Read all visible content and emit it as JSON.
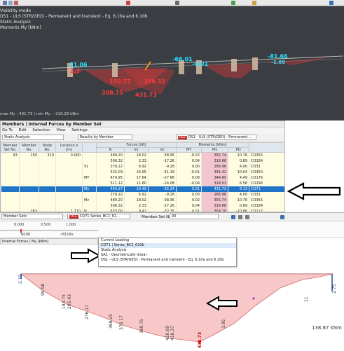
{
  "view3d": {
    "info_lines": [
      "Visibility mode",
      "DS1 - ULS (STR/GEO) - Permanent and transient - Eq. 6.10a and 6.10b",
      "Static Analysis",
      "Moments My [kNm]"
    ],
    "footer": "max My : 431.73 | min My : -210.29 kNm",
    "labels_red": [
      "150.57",
      "169.32",
      "308.75",
      "431.73",
      "2.7"
    ],
    "labels_cyan": [
      "-21.06",
      "-66.01",
      "-0.01",
      "-81.66",
      "-1.89"
    ]
  },
  "panel": {
    "title": "Members | Internal Forces by Member Set",
    "menu": [
      "Go To",
      "Edit",
      "Selection",
      "View",
      "Settings"
    ],
    "analysis": "Static Analysis",
    "results": "Results by Member",
    "combo_badge": "ULS",
    "combo_text": "DS1 - ULS (STR/GEO) - Permanent ...",
    "columns": [
      "Member Set No.",
      "Member No.",
      "Node No.",
      "Location x [m]",
      "",
      "N",
      "Vy",
      "Vz",
      "MT",
      "My",
      "Mz",
      ""
    ],
    "group_forces": "Forces [kN]",
    "group_moments": "Moments [kNm]",
    "rows": [
      {
        "set": "93",
        "member": "150",
        "node": "310",
        "loc": "0.000",
        "sym": "",
        "n": "489.20",
        "vy": "18.02",
        "vz": "-38.95",
        "mt": "-0.02",
        "my": "355.74",
        "mz": "10.76",
        "co": "CO355"
      },
      {
        "set": "",
        "member": "",
        "node": "",
        "loc": "",
        "sym": "",
        "n": "506.32",
        "vy": "2.33",
        "vz": "-17.26",
        "mt": "0.04",
        "my": "316.68",
        "mz": "0.89",
        "co": "CO184"
      },
      {
        "set": "",
        "member": "",
        "node": "",
        "loc": "",
        "sym": "Vz",
        "n": "278.22",
        "vy": "6.92",
        "vz": "-9.28",
        "mt": "0.00",
        "my": "166.96",
        "mz": "4.00",
        "co": "CO31"
      },
      {
        "set": "",
        "member": "",
        "node": "",
        "loc": "",
        "sym": "",
        "n": "525.03",
        "vy": "16.95",
        "vz": "-41.19",
        "mt": "-0.01",
        "my": "391.42",
        "mz": "10.04",
        "co": "CO350"
      },
      {
        "set": "",
        "member": "",
        "node": "",
        "loc": "",
        "sym": "MT",
        "n": "474.95",
        "vy": "17.64",
        "vz": "-27.66",
        "mt": "0.09",
        "my": "344.65",
        "mz": "4.49",
        "co": "CO176"
      },
      {
        "set": "",
        "member": "",
        "node": "",
        "loc": "",
        "sym": "",
        "n": "511.12",
        "vy": "11.60",
        "vz": "-24.08",
        "mt": "-0.04",
        "my": "318.03",
        "mz": "6.56",
        "co": "CO296"
      },
      {
        "set": "",
        "member": "",
        "node": "",
        "loc": "",
        "sym": "My",
        "n": "404.27",
        "vy": "10.49",
        "vz": "-25.24",
        "mt": "0.01",
        "my": "431.73",
        "mz": "6.13",
        "co": "CO71",
        "selected": true
      },
      {
        "set": "",
        "member": "",
        "node": "",
        "loc": "",
        "sym": "",
        "n": "278.22",
        "vy": "6.92",
        "vz": "-9.28",
        "mt": "0.00",
        "my": "166.96",
        "mz": "4.00",
        "co": "CO31"
      },
      {
        "set": "",
        "member": "",
        "node": "",
        "loc": "",
        "sym": "Mz",
        "n": "489.20",
        "vy": "18.02",
        "vz": "-38.95",
        "mt": "-0.02",
        "my": "355.74",
        "mz": "10.76",
        "co": "CO355"
      },
      {
        "set": "",
        "member": "",
        "node": "",
        "loc": "",
        "sym": "",
        "n": "506.32",
        "vy": "2.33",
        "vz": "-17.26",
        "mt": "0.04",
        "my": "316.68",
        "mz": "0.89",
        "co": "CO184"
      },
      {
        "set": "",
        "member": "283",
        "node": "",
        "loc": "1.710",
        "sym": "N",
        "n": "633.00",
        "vy": "9.42",
        "vz": "-32.75",
        "mt": "0.01",
        "my": "354.10",
        "mz": "-10.86",
        "co": "CO117"
      }
    ]
  },
  "bottom": {
    "member_sets_label": "Member Sets",
    "combo_badge": "ULS",
    "combo_code": "CO71",
    "combo_short": "Series_BC2_61...",
    "member_set_no_label": "Member Set No.",
    "member_set_no": "93",
    "ruler_ticks": [
      "0.000",
      "0.500",
      "1.000"
    ],
    "ruler_nodes": [
      "N196",
      "-M118x"
    ],
    "diagram_title": "Internal Forces | My [kNm]",
    "dropdown_items": [
      "Current Loading",
      "CO71 | Series_BC2_610b",
      "Static Analysis",
      "SA1 - Geometrically linear",
      "DS1 - ULS (STR/GEO) - Permanent and transient - Eq. 6.10a and 6.10b"
    ],
    "diagram_labels": [
      "-2.15",
      "90.98",
      "183.75",
      "205.43",
      "276.17",
      "368.25",
      "376.17",
      "389.75",
      "410.69",
      "416.37",
      "431.73",
      "3.95",
      "11",
      "138.87 kNm",
      "2.75"
    ]
  }
}
